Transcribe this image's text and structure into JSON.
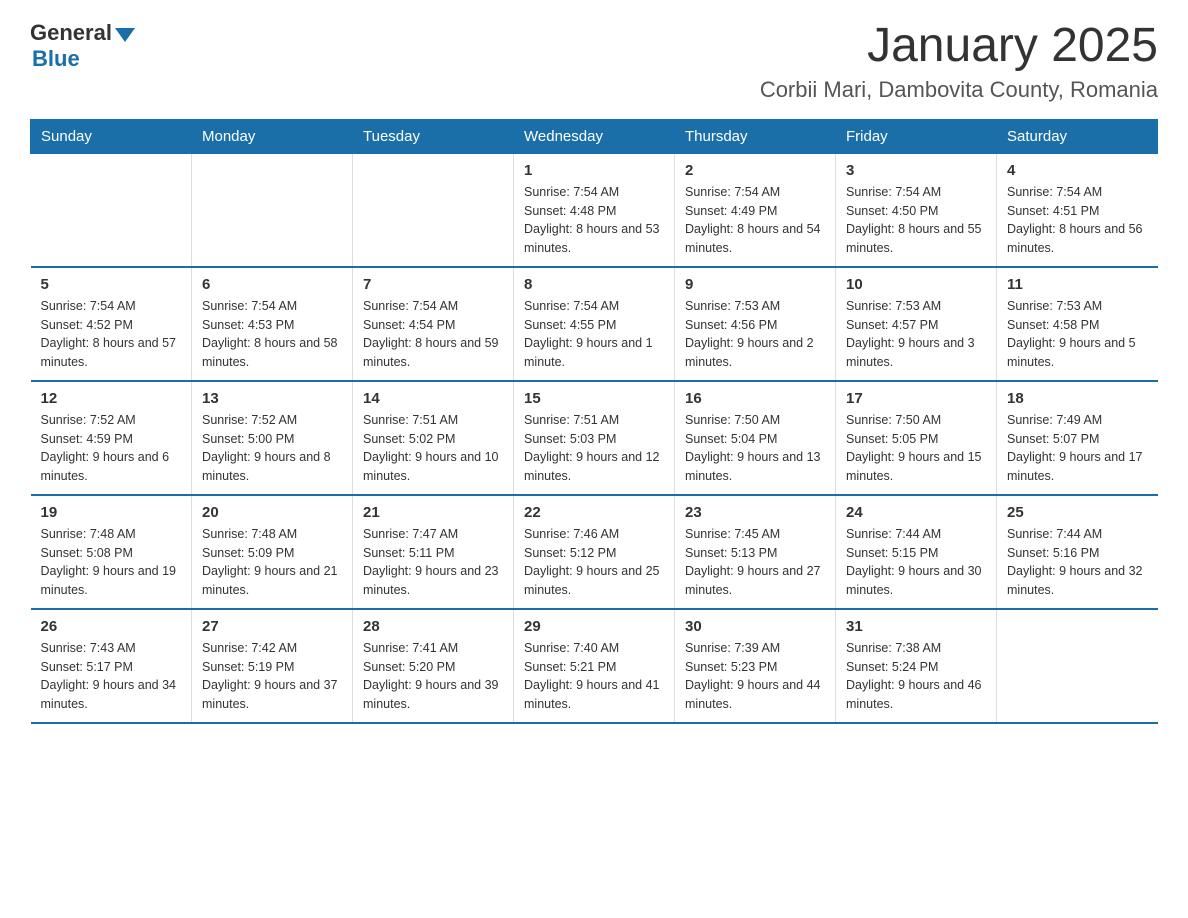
{
  "logo": {
    "general": "General",
    "blue": "Blue"
  },
  "title": "January 2025",
  "subtitle": "Corbii Mari, Dambovita County, Romania",
  "days_of_week": [
    "Sunday",
    "Monday",
    "Tuesday",
    "Wednesday",
    "Thursday",
    "Friday",
    "Saturday"
  ],
  "weeks": [
    [
      {
        "num": "",
        "info": ""
      },
      {
        "num": "",
        "info": ""
      },
      {
        "num": "",
        "info": ""
      },
      {
        "num": "1",
        "info": "Sunrise: 7:54 AM\nSunset: 4:48 PM\nDaylight: 8 hours\nand 53 minutes."
      },
      {
        "num": "2",
        "info": "Sunrise: 7:54 AM\nSunset: 4:49 PM\nDaylight: 8 hours\nand 54 minutes."
      },
      {
        "num": "3",
        "info": "Sunrise: 7:54 AM\nSunset: 4:50 PM\nDaylight: 8 hours\nand 55 minutes."
      },
      {
        "num": "4",
        "info": "Sunrise: 7:54 AM\nSunset: 4:51 PM\nDaylight: 8 hours\nand 56 minutes."
      }
    ],
    [
      {
        "num": "5",
        "info": "Sunrise: 7:54 AM\nSunset: 4:52 PM\nDaylight: 8 hours\nand 57 minutes."
      },
      {
        "num": "6",
        "info": "Sunrise: 7:54 AM\nSunset: 4:53 PM\nDaylight: 8 hours\nand 58 minutes."
      },
      {
        "num": "7",
        "info": "Sunrise: 7:54 AM\nSunset: 4:54 PM\nDaylight: 8 hours\nand 59 minutes."
      },
      {
        "num": "8",
        "info": "Sunrise: 7:54 AM\nSunset: 4:55 PM\nDaylight: 9 hours\nand 1 minute."
      },
      {
        "num": "9",
        "info": "Sunrise: 7:53 AM\nSunset: 4:56 PM\nDaylight: 9 hours\nand 2 minutes."
      },
      {
        "num": "10",
        "info": "Sunrise: 7:53 AM\nSunset: 4:57 PM\nDaylight: 9 hours\nand 3 minutes."
      },
      {
        "num": "11",
        "info": "Sunrise: 7:53 AM\nSunset: 4:58 PM\nDaylight: 9 hours\nand 5 minutes."
      }
    ],
    [
      {
        "num": "12",
        "info": "Sunrise: 7:52 AM\nSunset: 4:59 PM\nDaylight: 9 hours\nand 6 minutes."
      },
      {
        "num": "13",
        "info": "Sunrise: 7:52 AM\nSunset: 5:00 PM\nDaylight: 9 hours\nand 8 minutes."
      },
      {
        "num": "14",
        "info": "Sunrise: 7:51 AM\nSunset: 5:02 PM\nDaylight: 9 hours\nand 10 minutes."
      },
      {
        "num": "15",
        "info": "Sunrise: 7:51 AM\nSunset: 5:03 PM\nDaylight: 9 hours\nand 12 minutes."
      },
      {
        "num": "16",
        "info": "Sunrise: 7:50 AM\nSunset: 5:04 PM\nDaylight: 9 hours\nand 13 minutes."
      },
      {
        "num": "17",
        "info": "Sunrise: 7:50 AM\nSunset: 5:05 PM\nDaylight: 9 hours\nand 15 minutes."
      },
      {
        "num": "18",
        "info": "Sunrise: 7:49 AM\nSunset: 5:07 PM\nDaylight: 9 hours\nand 17 minutes."
      }
    ],
    [
      {
        "num": "19",
        "info": "Sunrise: 7:48 AM\nSunset: 5:08 PM\nDaylight: 9 hours\nand 19 minutes."
      },
      {
        "num": "20",
        "info": "Sunrise: 7:48 AM\nSunset: 5:09 PM\nDaylight: 9 hours\nand 21 minutes."
      },
      {
        "num": "21",
        "info": "Sunrise: 7:47 AM\nSunset: 5:11 PM\nDaylight: 9 hours\nand 23 minutes."
      },
      {
        "num": "22",
        "info": "Sunrise: 7:46 AM\nSunset: 5:12 PM\nDaylight: 9 hours\nand 25 minutes."
      },
      {
        "num": "23",
        "info": "Sunrise: 7:45 AM\nSunset: 5:13 PM\nDaylight: 9 hours\nand 27 minutes."
      },
      {
        "num": "24",
        "info": "Sunrise: 7:44 AM\nSunset: 5:15 PM\nDaylight: 9 hours\nand 30 minutes."
      },
      {
        "num": "25",
        "info": "Sunrise: 7:44 AM\nSunset: 5:16 PM\nDaylight: 9 hours\nand 32 minutes."
      }
    ],
    [
      {
        "num": "26",
        "info": "Sunrise: 7:43 AM\nSunset: 5:17 PM\nDaylight: 9 hours\nand 34 minutes."
      },
      {
        "num": "27",
        "info": "Sunrise: 7:42 AM\nSunset: 5:19 PM\nDaylight: 9 hours\nand 37 minutes."
      },
      {
        "num": "28",
        "info": "Sunrise: 7:41 AM\nSunset: 5:20 PM\nDaylight: 9 hours\nand 39 minutes."
      },
      {
        "num": "29",
        "info": "Sunrise: 7:40 AM\nSunset: 5:21 PM\nDaylight: 9 hours\nand 41 minutes."
      },
      {
        "num": "30",
        "info": "Sunrise: 7:39 AM\nSunset: 5:23 PM\nDaylight: 9 hours\nand 44 minutes."
      },
      {
        "num": "31",
        "info": "Sunrise: 7:38 AM\nSunset: 5:24 PM\nDaylight: 9 hours\nand 46 minutes."
      },
      {
        "num": "",
        "info": ""
      }
    ]
  ]
}
